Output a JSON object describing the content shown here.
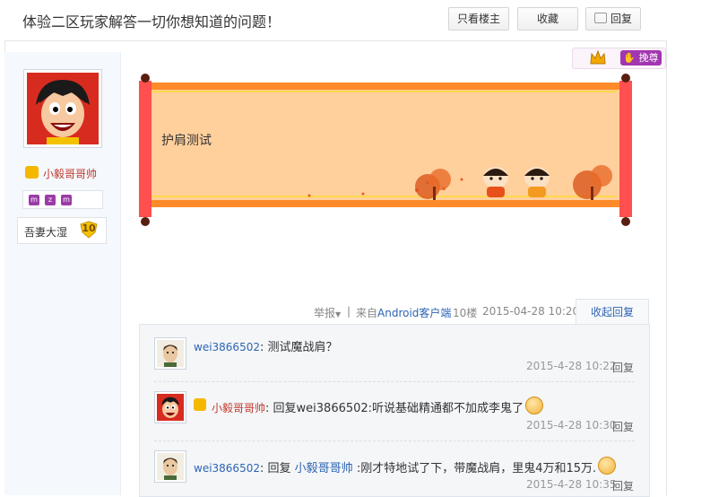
{
  "header": {
    "title": "体验二区玩家解答一切你想知道的问题！",
    "buttons": {
      "only_op": "只看楼主",
      "favorite": "收藏",
      "reply": "回复"
    }
  },
  "author": {
    "name": "小毅哥哥帅",
    "badges": [
      "m",
      "z",
      "m"
    ],
    "level_name": "吾妻大湿",
    "level": "10"
  },
  "post": {
    "tag_label": "挽尊",
    "content": "护肩测试",
    "meta": {
      "report": "举报",
      "source_prefix": "来自",
      "client": "Android客户端",
      "floor": "10楼",
      "time": "2015-04-28 10:20",
      "fold": "收起回复"
    }
  },
  "replies": [
    {
      "user": "wei3866502",
      "text": "测试魔战肩？",
      "time": "2015-4-28 10:22",
      "action": "回复",
      "emoji": false
    },
    {
      "user": "小毅哥哥帅",
      "text": "回复wei3866502:听说基础精通都不加成李鬼了",
      "time": "2015-4-28 10:30",
      "action": "回复",
      "emoji": true
    },
    {
      "user": "wei3866502",
      "prefix": "回复",
      "mention": "小毅哥哥帅",
      "text": ":刚才特地试了下，带魔战肩，里鬼4万和15万.",
      "time": "2015-4-28 10:35",
      "action": "回复",
      "emoji": true
    }
  ],
  "colors": {
    "link": "#2d64b3",
    "vip_name": "#c0392b",
    "scroll_orange": "#ff8a2a",
    "scroll_rod": "#ff4f4f"
  }
}
